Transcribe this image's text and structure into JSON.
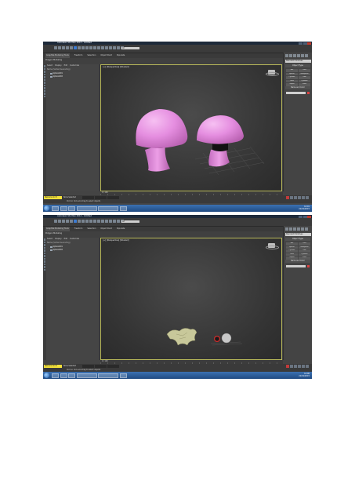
{
  "colors": {
    "background": "#ffffff",
    "ui_dark": "#444444",
    "viewport_border": "#b8b85a",
    "mushroom_pink": "#e58ee0",
    "status_yellow": "#f2e03a",
    "taskbar_blue": "#2a5a98"
  },
  "shots": [
    {
      "window_title": "Autodesk 3ds Max 2014 - Untitled",
      "ribbon_tabs": [
        "Graphite Modeling Tools",
        "Freeform",
        "Selection",
        "Object Paint",
        "Populate"
      ],
      "subribbon": "Polygon Modeling",
      "toolbar_dropdown": "All",
      "explorer_menu": [
        "Select",
        "Display",
        "Edit",
        "Customize"
      ],
      "explorer_header": "Name (Sorted Ascending)",
      "explorer_items": [
        "Sphere001",
        "Sphere002"
      ],
      "viewport_label": "[+] [Perspective] [Shaded]",
      "command_dropdown": "Standard Primitives",
      "command_rollout": "Object Type",
      "command_buttons": [
        "Box",
        "Cone",
        "Sphere",
        "GeoSphere",
        "Cylinder",
        "Tube",
        "Torus",
        "Pyramid",
        "Teapot",
        "Plane"
      ],
      "command_rollout2": "Name and Color",
      "timeline_label": "0 / 100",
      "status_mode": "Welcome to M",
      "status_selection": "None Selected",
      "status_message": "Click or click-and-drag to select objects",
      "tray_time": "14:01",
      "tray_date": "21/01/2015",
      "scene": "mushrooms"
    },
    {
      "window_title": "Autodesk 3ds Max 2014 - Untitled",
      "ribbon_tabs": [
        "Graphite Modeling Tools",
        "Freeform",
        "Selection",
        "Object Paint",
        "Populate"
      ],
      "subribbon": "Polygon Modeling",
      "toolbar_dropdown": "All",
      "explorer_menu": [
        "Select",
        "Display",
        "Edit",
        "Customize"
      ],
      "explorer_header": "Name (Sorted Ascending)",
      "explorer_items": [
        "Sphere001",
        "Sphere002"
      ],
      "viewport_label": "[+] [Perspective] [Shaded]",
      "command_dropdown": "Standard Primitives",
      "command_rollout": "Object Type",
      "command_buttons": [
        "Box",
        "Cone",
        "Sphere",
        "GeoSphere",
        "Cylinder",
        "Tube",
        "Torus",
        "Pyramid",
        "Teapot",
        "Plane"
      ],
      "command_rollout2": "Name and Color",
      "timeline_label": "0 / 100",
      "status_mode": "Welcome to M",
      "status_selection": "None Selected",
      "status_message": "Click or click-and-drag to select objects",
      "tray_time": "14:06",
      "tray_date": "21/01/2015",
      "scene": "small-objects"
    }
  ]
}
